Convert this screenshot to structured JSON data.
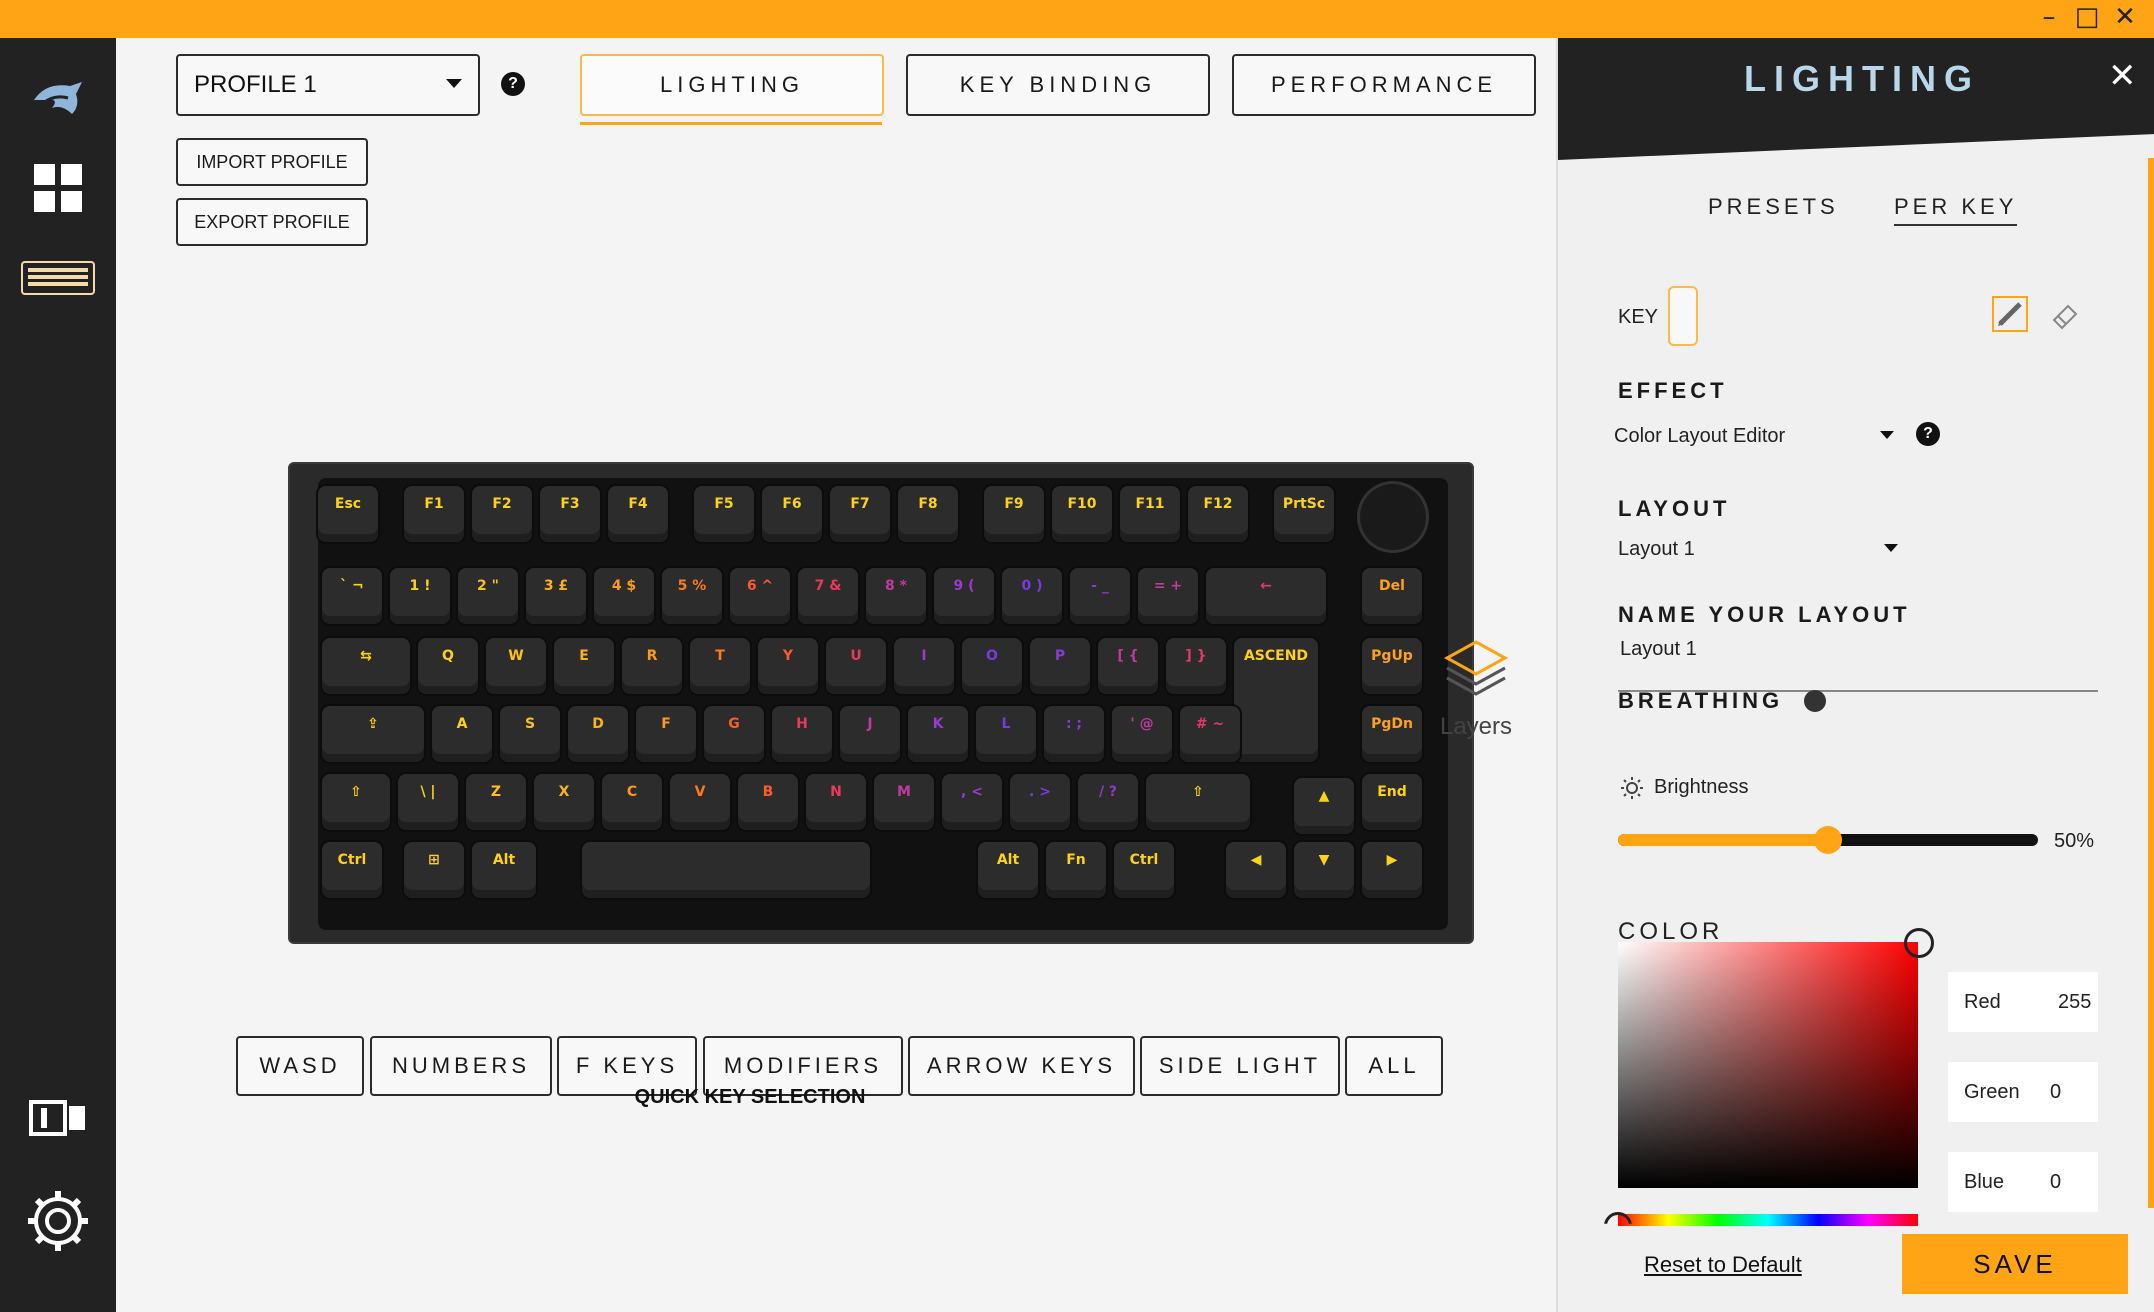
{
  "window": {
    "minimize_glyph": "–",
    "maximize_glyph": "□",
    "close_glyph": "✕"
  },
  "colors": {
    "accent": "#ffa414",
    "sidebar": "#222222",
    "panel_bg": "#f0f0f0"
  },
  "sidebar": {
    "items": [
      {
        "icon": "wolf-logo-icon"
      },
      {
        "icon": "dashboard-grid-icon"
      },
      {
        "icon": "keyboard-icon"
      },
      {
        "icon": "device-layout-icon"
      },
      {
        "icon": "gear-icon"
      }
    ]
  },
  "profile": {
    "selected": "PROFILE 1",
    "help": "?",
    "import_label": "IMPORT PROFILE",
    "export_label": "EXPORT PROFILE"
  },
  "tabs": [
    {
      "label": "LIGHTING",
      "active": true
    },
    {
      "label": "KEY BINDING"
    },
    {
      "label": "PERFORMANCE"
    }
  ],
  "keyboard": {
    "row0": [
      "Esc",
      "F1",
      "F2",
      "F3",
      "F4",
      "F5",
      "F6",
      "F7",
      "F8",
      "F9",
      "F10",
      "F11",
      "F12",
      "PrtSc"
    ],
    "row1": [
      "` ¬",
      "1 !",
      "2 \"",
      "3 £",
      "4 $",
      "5 %",
      "6 ^",
      "7 &",
      "8 *",
      "9 (",
      "0 )",
      "- _",
      "= +",
      "←",
      "Del"
    ],
    "row2": [
      "⇆",
      "Q",
      "W",
      "E",
      "R",
      "T",
      "Y",
      "U",
      "I",
      "O",
      "P",
      "[ {",
      "] }",
      "ASCEND",
      "PgUp"
    ],
    "row3": [
      "⇪",
      "A",
      "S",
      "D",
      "F",
      "G",
      "H",
      "J",
      "K",
      "L",
      ": ;",
      "' @",
      "# ~",
      "PgDn"
    ],
    "row4": [
      "⇧",
      "\\ |",
      "Z",
      "X",
      "C",
      "V",
      "B",
      "N",
      "M",
      ", <",
      ". >",
      "/ ?",
      "⇧",
      "▲",
      "End"
    ],
    "row5": [
      "Ctrl",
      "⊞",
      "Alt",
      "",
      "Alt",
      "Fn",
      "Ctrl",
      "◀",
      "▼",
      "▶"
    ]
  },
  "layers_label": "Layers",
  "quick_keys": {
    "buttons": [
      "WASD",
      "NUMBERS",
      "F KEYS",
      "MODIFIERS",
      "ARROW KEYS",
      "SIDE LIGHT",
      "ALL"
    ],
    "caption": "QUICK KEY SELECTION"
  },
  "panel": {
    "title": "LIGHTING",
    "close": "✕",
    "subtabs": [
      {
        "label": "PRESETS"
      },
      {
        "label": "PER KEY",
        "active": true
      }
    ],
    "key_label": "KEY",
    "effect_title": "EFFECT",
    "effect_value": "Color Layout Editor",
    "effect_help": "?",
    "layout_title": "LAYOUT",
    "layout_value": "Layout 1",
    "name_title": "NAME YOUR LAYOUT",
    "name_value": "Layout 1",
    "breathing_title": "BREATHING",
    "brightness_label": "Brightness",
    "brightness_value": "50%",
    "brightness_fraction": 0.5,
    "color_title": "COLOR",
    "rgb": {
      "red_label": "Red",
      "red": "255",
      "green_label": "Green",
      "green": "0",
      "blue_label": "Blue",
      "blue": "0"
    },
    "reset_label": "Reset to Default",
    "save_label": "SAVE"
  }
}
